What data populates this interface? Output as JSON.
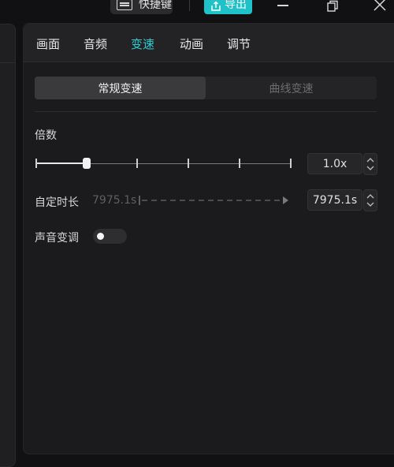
{
  "titlebar": {
    "shortcut_label": "快捷键",
    "export_label": "导出",
    "accent_color": "#1fc2c9"
  },
  "tabs": [
    {
      "label": "画面",
      "active": false
    },
    {
      "label": "音频",
      "active": false
    },
    {
      "label": "变速",
      "active": true
    },
    {
      "label": "动画",
      "active": false
    },
    {
      "label": "调节",
      "active": false
    }
  ],
  "speed_mode": {
    "options": [
      "常规变速",
      "曲线变速"
    ],
    "selected": "常规变速"
  },
  "multiplier": {
    "label": "倍数",
    "value": "1.0x",
    "slider_level": 0.2
  },
  "custom_duration": {
    "label": "自定时长",
    "from_value": "7975.1s",
    "value": "7975.1s"
  },
  "voice_change": {
    "label": "声音变调",
    "enabled": false
  }
}
